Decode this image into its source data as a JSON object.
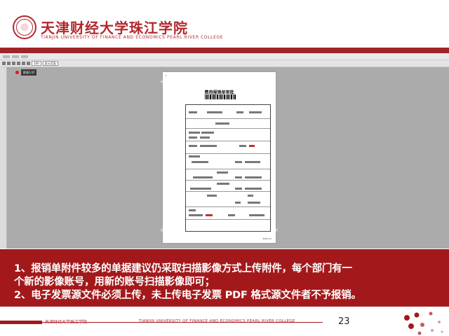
{
  "header": {
    "school_name_cn": "天津财经大学珠江学院",
    "school_name_en": "TIANJIN UNIVERSITY OF FINANCE AND ECONOMICS PEARL RIVER COLLEGE"
  },
  "app": {
    "toolbar": {
      "zoom_value": "100",
      "view_select": "显示页面"
    },
    "attachment_tab": "影像1.tif",
    "document": {
      "title": "费用报销单审批",
      "barcode_number": "",
      "footer_text": "2020-11"
    }
  },
  "banner": {
    "line1": "1、报销单附件较多的单据建议仍采取扫描影像方式上传附件，每个部门有一",
    "line2": "个新的影像账号，用新的账号扫描影像即可；",
    "line3": "2、电子发票源文件必须上传，未上传电子发票 PDF 格式源文件者不予报销。"
  },
  "footer": {
    "school_cn": "天津财经大学珠江学院",
    "school_en": "TIANJIN UNIVERSITY OF FINANCE AND ECONOMICS PEARL RIVER COLLEGE",
    "page_number": "23"
  },
  "colors": {
    "brand_red": "#a3191b",
    "viewer_gray": "#ababab"
  }
}
